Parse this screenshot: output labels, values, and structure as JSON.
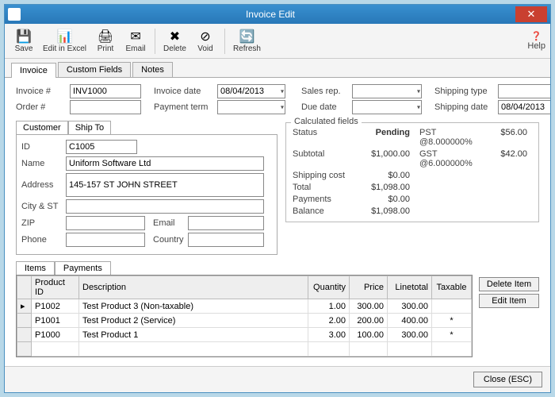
{
  "window": {
    "title": "Invoice Edit"
  },
  "toolbar": {
    "save": "Save",
    "excel": "Edit in Excel",
    "print": "Print",
    "email": "Email",
    "delete": "Delete",
    "void": "Void",
    "refresh": "Refresh",
    "help": "Help"
  },
  "tabs": {
    "invoice": "Invoice",
    "custom": "Custom Fields",
    "notes": "Notes"
  },
  "head": {
    "invoice_no_lbl": "Invoice #",
    "invoice_no": "INV1000",
    "order_no_lbl": "Order #",
    "order_no": "",
    "invoice_date_lbl": "Invoice date",
    "invoice_date": "08/04/2013",
    "payment_term_lbl": "Payment term",
    "payment_term": "",
    "sales_rep_lbl": "Sales rep.",
    "sales_rep": "",
    "due_date_lbl": "Due date",
    "due_date": "",
    "ship_type_lbl": "Shipping type",
    "ship_type": "",
    "ship_date_lbl": "Shipping date",
    "ship_date": "08/04/2013"
  },
  "cust_tabs": {
    "customer": "Customer",
    "shipto": "Ship To"
  },
  "cust": {
    "id_lbl": "ID",
    "id": "C1005",
    "name_lbl": "Name",
    "name": "Uniform Software Ltd",
    "addr_lbl": "Address",
    "addr": "145-157 ST JOHN STREET",
    "cityst_lbl": "City & ST",
    "cityst": "",
    "zip_lbl": "ZIP",
    "zip": "",
    "email_lbl": "Email",
    "email": "",
    "phone_lbl": "Phone",
    "phone": "",
    "country_lbl": "Country",
    "country": ""
  },
  "calc": {
    "title": "Calculated fields",
    "status_lbl": "Status",
    "status": "Pending",
    "subtotal_lbl": "Subtotal",
    "subtotal": "$1,000.00",
    "shipcost_lbl": "Shipping cost",
    "shipcost": "$0.00",
    "total_lbl": "Total",
    "total": "$1,098.00",
    "payments_lbl": "Payments",
    "payments": "$0.00",
    "balance_lbl": "Balance",
    "balance": "$1,098.00",
    "pst_lbl": "PST @8.000000%",
    "pst": "$56.00",
    "gst_lbl": "GST @6.000000%",
    "gst": "$42.00"
  },
  "items_tabs": {
    "items": "Items",
    "payments": "Payments"
  },
  "items": {
    "cols": {
      "pid": "Product ID",
      "desc": "Description",
      "qty": "Quantity",
      "price": "Price",
      "line": "Linetotal",
      "tax": "Taxable"
    },
    "rows": [
      {
        "pid": "P1002",
        "desc": "Test Product 3 (Non-taxable)",
        "qty": "1.00",
        "price": "300.00",
        "line": "300.00",
        "tax": ""
      },
      {
        "pid": "P1001",
        "desc": "Test Product 2 (Service)",
        "qty": "2.00",
        "price": "200.00",
        "line": "400.00",
        "tax": "*"
      },
      {
        "pid": "P1000",
        "desc": "Test Product 1",
        "qty": "3.00",
        "price": "100.00",
        "line": "300.00",
        "tax": "*"
      }
    ],
    "delete_btn": "Delete Item",
    "edit_btn": "Edit Item"
  },
  "footer": {
    "close": "Close (ESC)"
  }
}
